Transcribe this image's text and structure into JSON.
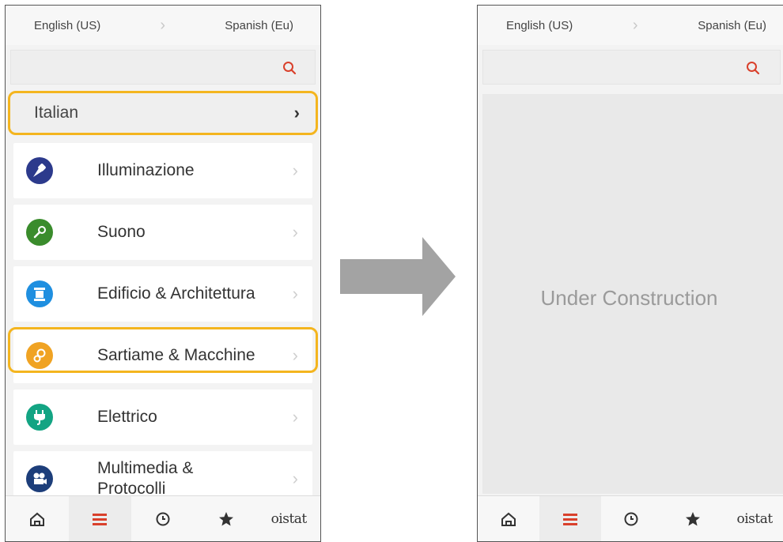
{
  "left_screen": {
    "header": {
      "from_lang": "English (US)",
      "to_lang": "Spanish (Eu)",
      "separator": "›"
    },
    "search": {
      "placeholder": "",
      "icon": "search-icon"
    },
    "selected_language": {
      "label": "Italian",
      "chevron": "›"
    },
    "categories": [
      {
        "label": "Illuminazione",
        "icon": "spotlight-icon",
        "color": "#2c3a8c"
      },
      {
        "label": "Suono",
        "icon": "microphone-icon",
        "color": "#3a8c2c"
      },
      {
        "label": "Edificio & Architettura",
        "icon": "column-icon",
        "color": "#1f8fe0"
      },
      {
        "label": "Sartiame & Macchine",
        "icon": "gears-icon",
        "color": "#f0a323"
      },
      {
        "label": "Elettrico",
        "icon": "plug-icon",
        "color": "#13a483"
      },
      {
        "label": "Multimedia & Protocolli",
        "icon": "camera-icon",
        "color": "#1d3e7a"
      }
    ],
    "tabbar": {
      "logo": "oistat"
    }
  },
  "right_screen": {
    "header": {
      "from_lang": "English (US)",
      "to_lang": "Spanish (Eu)",
      "separator": "›"
    },
    "message": "Under Construction",
    "tabbar": {
      "logo": "oistat"
    }
  },
  "colors": {
    "highlight": "#f4b51f",
    "accent": "#d9402b",
    "arrow": "#a3a3a3"
  }
}
